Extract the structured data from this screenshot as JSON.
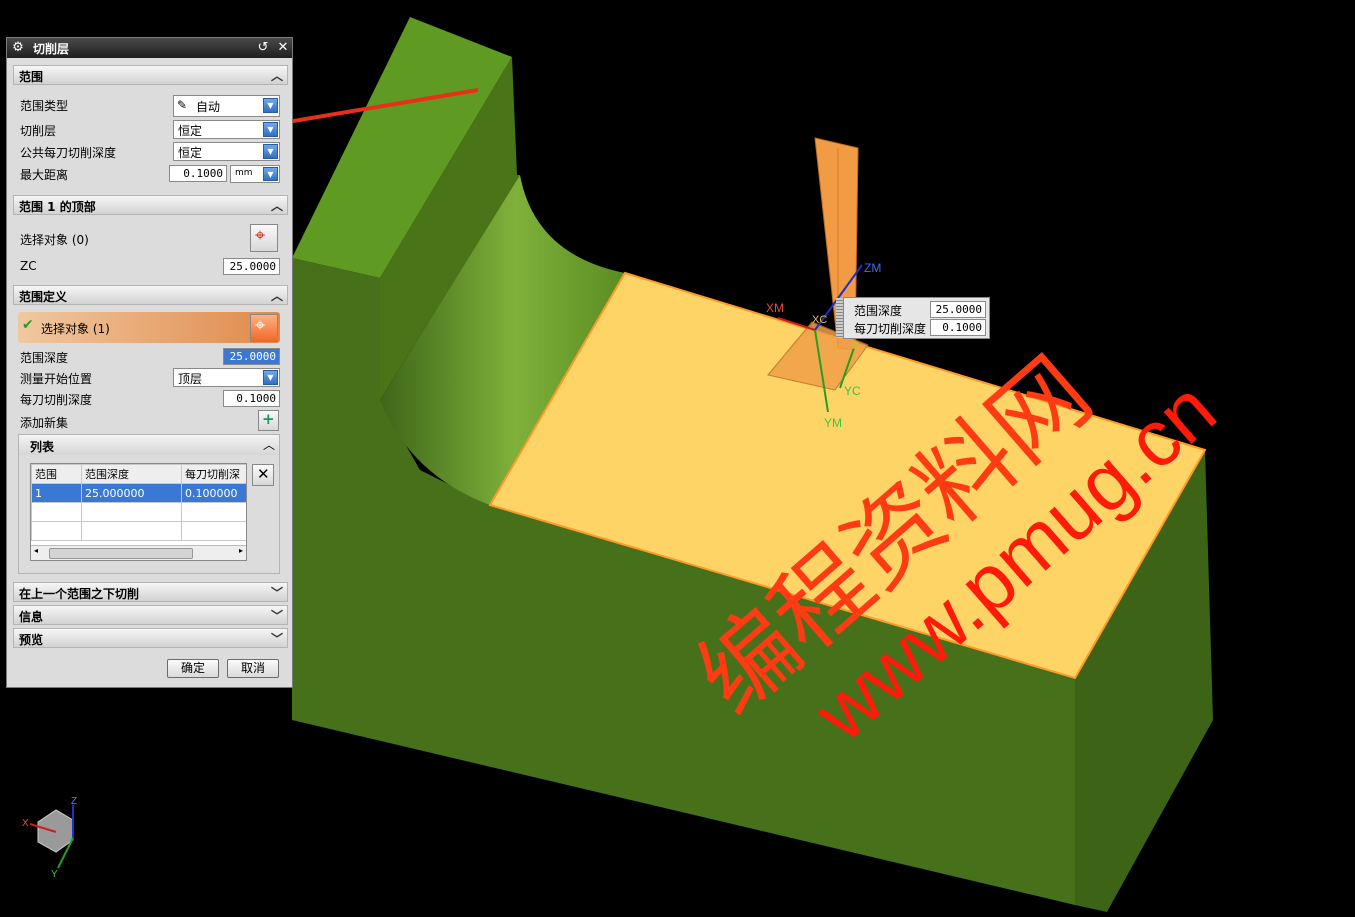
{
  "dialog": {
    "title": "切削层",
    "section_range": {
      "title": "范围",
      "range_type_label": "范围类型",
      "range_type_value": "自动",
      "cut_levels_label": "切削层",
      "cut_levels_value": "恒定",
      "common_depth_label": "公共每刀切削深度",
      "common_depth_value": "恒定",
      "max_distance_label": "最大距离",
      "max_distance_value": "0.1000",
      "max_distance_unit": "mm"
    },
    "section_top": {
      "title": "范围 1 的顶部",
      "select_label": "选择对象 (0)",
      "zc_label": "ZC",
      "zc_value": "25.0000"
    },
    "section_def": {
      "title": "范围定义",
      "select_label": "选择对象 (1)",
      "range_depth_label": "范围深度",
      "range_depth_value": "25.0000",
      "measure_from_label": "测量开始位置",
      "measure_from_value": "顶层",
      "depth_per_cut_label": "每刀切削深度",
      "depth_per_cut_value": "0.1000",
      "add_set_label": "添加新集"
    },
    "list": {
      "title": "列表",
      "columns": [
        "范围",
        "范围深度",
        "每刀切削深"
      ],
      "rows": [
        [
          "1",
          "25.000000",
          "0.100000"
        ]
      ]
    },
    "collapsed_sections": [
      "在上一个范围之下切削",
      "信息",
      "预览"
    ],
    "ok_label": "确定",
    "cancel_label": "取消"
  },
  "viewport": {
    "popup": {
      "range_depth_label": "范围深度",
      "range_depth_value": "25.0000",
      "depth_per_cut_label": "每刀切削深度",
      "depth_per_cut_value": "0.1000"
    },
    "axes_labels": {
      "xm": "XM",
      "xc": "XC",
      "yc": "YC",
      "ym": "YM",
      "zm": "ZM"
    },
    "triad_labels": {
      "x": "X",
      "y": "Y",
      "z": "Z"
    },
    "watermark_1": "编程资料网",
    "watermark_2": "www.pmug.cn",
    "colors": {
      "background": "#000000",
      "part_green": "#4d7a1c",
      "face_highlight": "#ffd466",
      "watermark": "#ff3b14"
    }
  }
}
